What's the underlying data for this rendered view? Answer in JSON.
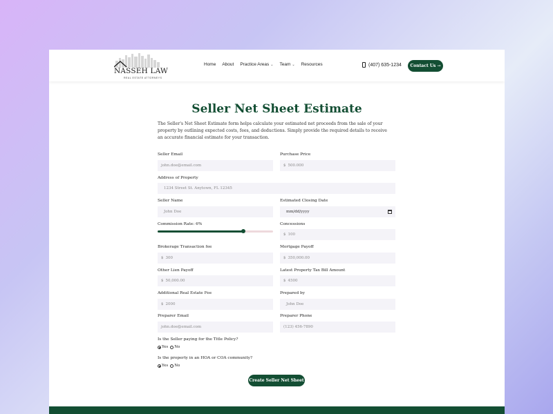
{
  "brand": {
    "name": "NASSEH LAW",
    "tagline": "REAL ESTATE ATTORNEYS",
    "colors": {
      "primary": "#134e33",
      "background": "#ffffff"
    }
  },
  "nav": {
    "items": [
      {
        "label": "Home",
        "dropdown": false
      },
      {
        "label": "About",
        "dropdown": false
      },
      {
        "label": "Practice Areas",
        "dropdown": true
      },
      {
        "label": "Team",
        "dropdown": true
      },
      {
        "label": "Resources",
        "dropdown": false
      }
    ],
    "phone": "(407) 635-1234",
    "phone_icon": "phone-icon",
    "contact_label": "Contact Us",
    "contact_arrow": "→"
  },
  "form": {
    "title": "Seller Net Sheet Estimate",
    "intro": "The Seller's Net Sheet Estimate form helps calculate your estimated net proceeds from the sale of your property by outlining expected costs, fees, and deductions. Simply provide the required details to receive an accurate financial estimate for your transaction.",
    "seller_email": {
      "label": "Seller Email",
      "placeholder": "john.doe@email.com"
    },
    "purchase_price": {
      "label": "Purchase Price",
      "prefix": "$",
      "placeholder": "500.000"
    },
    "address": {
      "label": "Address of Property",
      "placeholder": "1234 Street St. Anytown, FL 12345"
    },
    "seller_name": {
      "label": "Seller Name",
      "placeholder": "John Doe"
    },
    "closing_date": {
      "label": "Estimated Closing Date",
      "placeholder": "mm/dd/yyyy"
    },
    "commission": {
      "label": "Commission Rate: 6%",
      "value_fraction": 0.74
    },
    "concessions": {
      "label": "Concessions",
      "prefix": "$",
      "placeholder": "100"
    },
    "brokerage_fee": {
      "label": "Brokerage Transaction fee",
      "prefix": "$",
      "placeholder": "300"
    },
    "mortgage_payoff": {
      "label": "Mortgage Payoff",
      "prefix": "$",
      "placeholder": "350,000.00"
    },
    "other_lien": {
      "label": "Other Lien Payoff",
      "prefix": "$",
      "placeholder": "50,000.00"
    },
    "tax_bill": {
      "label": "Latest Property Tax Bill Amount",
      "prefix": "$",
      "placeholder": "4500"
    },
    "re_fee": {
      "label": "Additional Real Estate Fee",
      "prefix": "$",
      "placeholder": "2000"
    },
    "prepared_by": {
      "label": "Prepared by",
      "placeholder": "John Doe"
    },
    "preparer_email": {
      "label": "Preparer Email",
      "placeholder": "john.doe@email.com"
    },
    "preparer_phone": {
      "label": "Preparer Phone",
      "placeholder": "(123) 456-7890"
    },
    "title_policy": {
      "question": "Is the Seller paying for the Title Policy?",
      "yes": "Yes",
      "no": "No",
      "selected": "Yes"
    },
    "hoa": {
      "question": "Is the property in an HOA or COA community?",
      "yes": "Yes",
      "no": "No",
      "selected": "Yes"
    },
    "submit_label": "Create Seller Net Sheet"
  }
}
